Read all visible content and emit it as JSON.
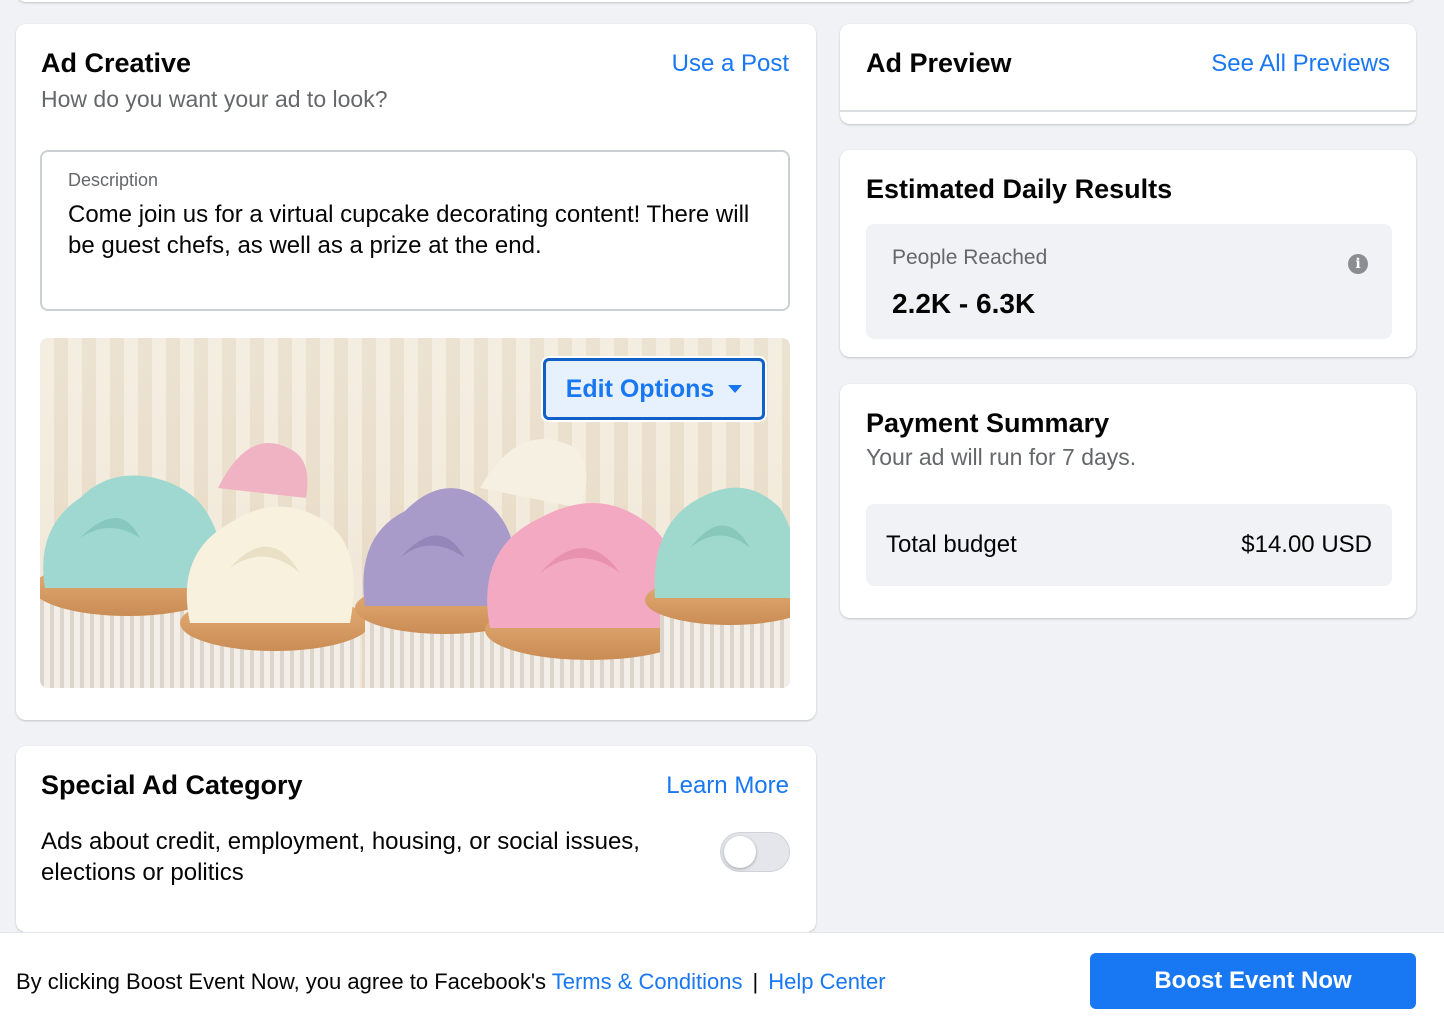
{
  "ad_creative": {
    "title": "Ad Creative",
    "subtitle": "How do you want your ad to look?",
    "use_post_link": "Use a Post",
    "description_label": "Description",
    "description_text": "Come join us for a virtual cupcake decorating content! There will be guest chefs, as well as a prize at the end.",
    "edit_options_label": "Edit Options",
    "image_subject": "cupcakes"
  },
  "special_ad": {
    "title": "Special Ad Category",
    "learn_more_link": "Learn More",
    "text": "Ads about credit, employment, housing, or social issues, elections or politics",
    "toggle_on": false
  },
  "ad_preview": {
    "title": "Ad Preview",
    "see_all_link": "See All Previews"
  },
  "estimated": {
    "title": "Estimated Daily Results",
    "reach_label": "People Reached",
    "reach_value": "2.2K - 6.3K",
    "info_icon": "i"
  },
  "payment": {
    "title": "Payment Summary",
    "subtitle": "Your ad will run for 7 days.",
    "budget_label": "Total budget",
    "budget_value": "$14.00 USD"
  },
  "footer": {
    "agreement_text": "By clicking Boost Event Now, you agree to Facebook's",
    "terms_link": "Terms & Conditions",
    "separator": "|",
    "help_link": "Help Center",
    "boost_button": "Boost Event Now"
  },
  "colors": {
    "accent": "#1877f2",
    "background": "#f0f2f5",
    "card": "#ffffff",
    "frosting": [
      "#9fd8d0",
      "#f7f1de",
      "#a99bc9",
      "#f4a9c3",
      "#9fd8cc",
      "#efb3c4"
    ]
  }
}
